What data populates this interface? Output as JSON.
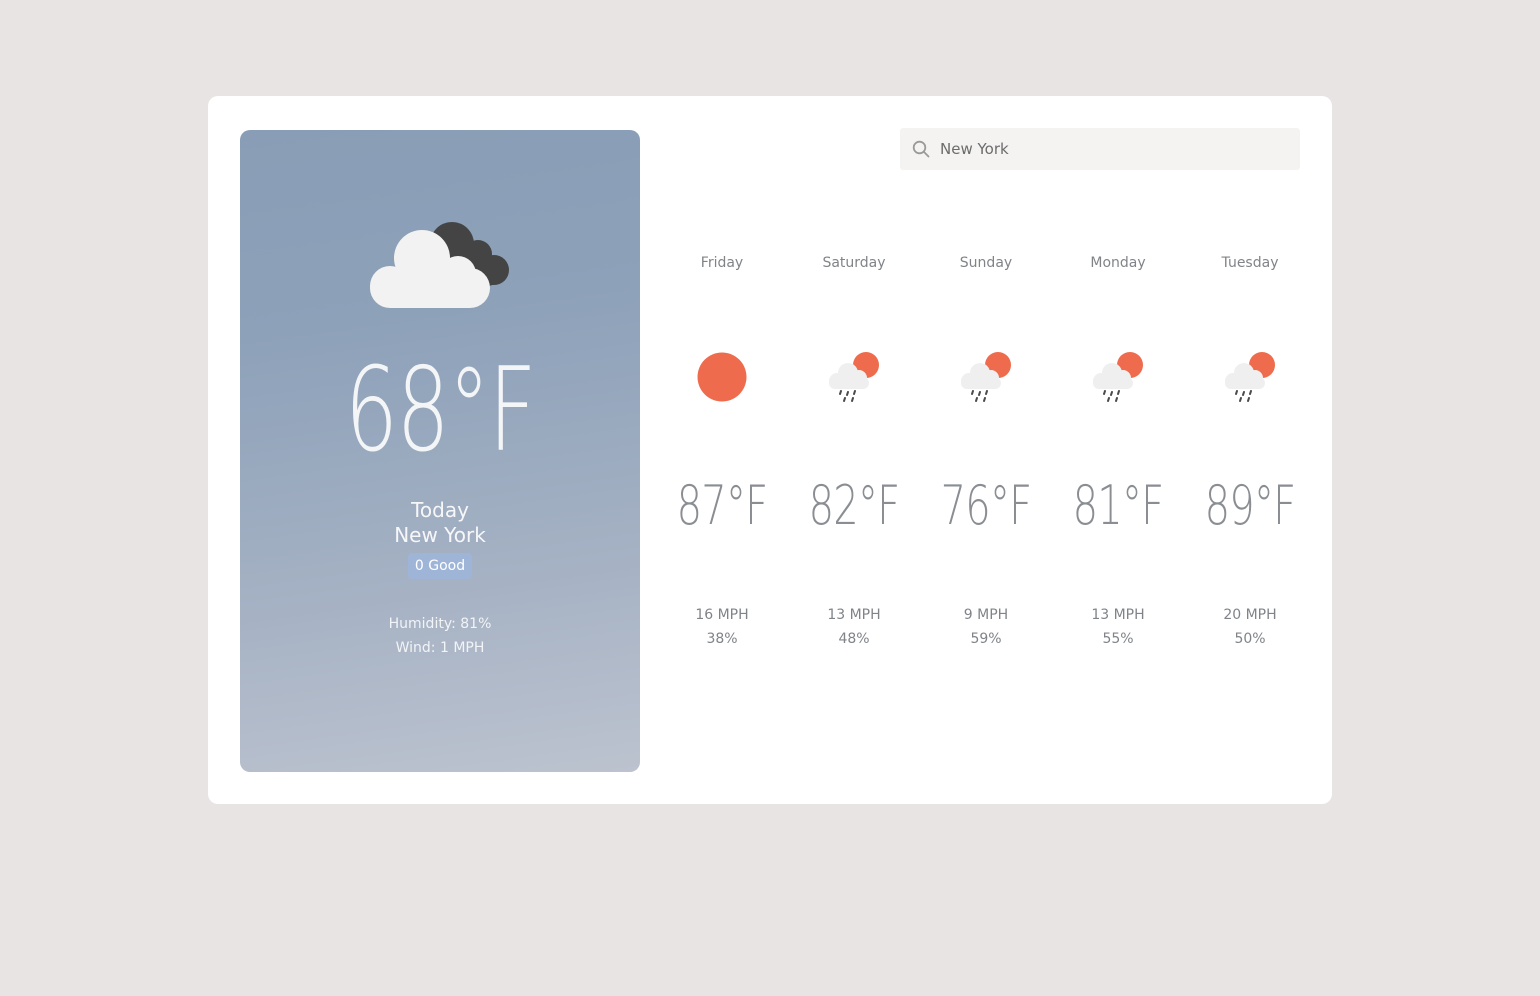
{
  "today": {
    "icon": "cloudy-icon",
    "temperature": "68°F",
    "label": "Today",
    "city": "New York",
    "aqi": "0 Good",
    "humidity": "Humidity: 81%",
    "wind": "Wind: 1 MPH"
  },
  "search": {
    "value": "New York",
    "icon": "search-icon"
  },
  "forecast": [
    {
      "day": "Friday",
      "icon": "sun-icon",
      "temp": "87°F",
      "wind": "16 MPH",
      "humidity": "38%"
    },
    {
      "day": "Saturday",
      "icon": "rain-sun-icon",
      "temp": "82°F",
      "wind": "13 MPH",
      "humidity": "48%"
    },
    {
      "day": "Sunday",
      "icon": "rain-sun-icon",
      "temp": "76°F",
      "wind": "9 MPH",
      "humidity": "59%"
    },
    {
      "day": "Monday",
      "icon": "rain-sun-icon",
      "temp": "81°F",
      "wind": "13 MPH",
      "humidity": "55%"
    },
    {
      "day": "Tuesday",
      "icon": "rain-sun-icon",
      "temp": "89°F",
      "wind": "20 MPH",
      "humidity": "50%"
    }
  ],
  "colors": {
    "sun": "#ee6c4d",
    "cloud_light": "#f2f2f2",
    "cloud_dark": "#444444",
    "aqi_good": "#9fb5d8"
  }
}
